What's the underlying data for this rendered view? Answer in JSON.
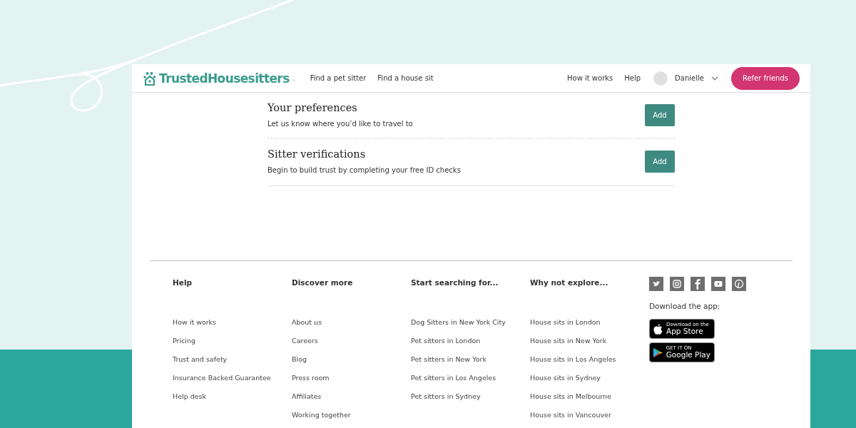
{
  "header": {
    "logo": {
      "text": "TrustedHousesitters",
      "mark": "™"
    },
    "nav_left": [
      "Find a pet sitter",
      "Find a house sit"
    ],
    "nav_right": [
      "How it works",
      "Help"
    ],
    "user": {
      "name": "Danielle"
    },
    "cta": "Refer friends"
  },
  "sections": [
    {
      "title": "Your preferences",
      "description": "Let us know where you’d like to travel to",
      "button": "Add",
      "kind": "dotted"
    },
    {
      "title": "Sitter verifications",
      "description": "Begin to build trust by completing your free ID checks",
      "button": "Add",
      "kind": "solid"
    }
  ],
  "footer": {
    "columns": [
      {
        "heading": "Help",
        "links": [
          "How it works",
          "Pricing",
          "Trust and safety",
          "Insurance Backed Guarantee",
          "Help desk"
        ]
      },
      {
        "heading": "Discover more",
        "links": [
          "About us",
          "Careers",
          "Blog",
          "Press room",
          "Affiliates",
          "Working together"
        ]
      },
      {
        "heading": "Start searching for...",
        "links": [
          "Dog Sitters in New York City",
          "Pet sitters in London",
          "Pet sitters in New York",
          "Pet sitters in Los Angeles",
          "Pet sitters in Sydney"
        ]
      },
      {
        "heading": "Why not explore...",
        "links": [
          "House sits in London",
          "House sits in New York",
          "House sits in Los Angeles",
          "House sits in Sydney",
          "House sits in Melbourne",
          "House sits in Vancouver"
        ]
      }
    ],
    "social": [
      {
        "kind": "twitter"
      },
      {
        "kind": "instagram"
      },
      {
        "kind": "facebook"
      },
      {
        "kind": "youtube"
      },
      {
        "kind": "pinterest"
      }
    ],
    "app_label": "Download the app:",
    "badges": [
      {
        "kind": "apple",
        "small": "Download on the",
        "big": "App Store"
      },
      {
        "kind": "google",
        "small": "GET IT ON",
        "big": "Google Play"
      }
    ]
  }
}
